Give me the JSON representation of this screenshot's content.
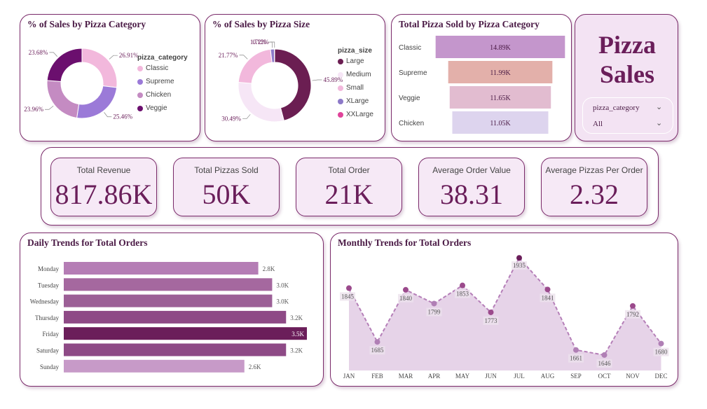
{
  "category_pct": {
    "title": "% of Sales by Pizza Category",
    "legend_title": "pizza_category",
    "colors": [
      "#f2b8dc",
      "#9b7ad8",
      "#c48bc2",
      "#6b0f6e"
    ],
    "labels": [
      "26.91%",
      "25.46%",
      "23.96%",
      "23.68%"
    ]
  },
  "size_pct": {
    "title": "% of Sales by Pizza Size",
    "legend_title": "pizza_size",
    "colors": [
      "#6b1e52",
      "#f6e6f6",
      "#f2b8dc",
      "#8c79c8",
      "#e0439a"
    ],
    "labels": [
      "45.89%",
      "30.49%",
      "21.77%",
      "1.72%",
      "0.12%"
    ]
  },
  "category_sold": {
    "title": "Total Pizza Sold by Pizza Category",
    "colors": [
      "#c496cc",
      "#e3b0aa",
      "#e2bcd0",
      "#ddd4ee"
    ],
    "value_labels": [
      "14.89K",
      "11.99K",
      "11.65K",
      "11.05K"
    ]
  },
  "brand": {
    "title_line1": "Pizza",
    "title_line2": "Sales",
    "filter_label": "pizza_category",
    "filter_value": "All"
  },
  "kpis": [
    {
      "label": "Total Revenue",
      "value": "817.86K"
    },
    {
      "label": "Total Pizzas Sold",
      "value": "50K"
    },
    {
      "label": "Total Order",
      "value": "21K"
    },
    {
      "label": "Average Order Value",
      "value": "38.31"
    },
    {
      "label": "Average Pizzas Per Order",
      "value": "2.32"
    }
  ],
  "daily": {
    "title": "Daily Trends for Total Orders",
    "colors": [
      "#b57db5",
      "#a5689f",
      "#9c5f96",
      "#8e4a86",
      "#6b1e5a",
      "#8e4a86",
      "#c79ac8"
    ],
    "value_labels": [
      "2.8K",
      "3.0K",
      "3.0K",
      "3.2K",
      "3.5K",
      "3.2K",
      "2.6K"
    ]
  },
  "monthly": {
    "title": "Monthly Trends for Total Orders"
  },
  "chart_data": [
    {
      "type": "pie",
      "title": "% of Sales by Pizza Category",
      "categories": [
        "Classic",
        "Supreme",
        "Chicken",
        "Veggie"
      ],
      "values": [
        26.91,
        25.46,
        23.96,
        23.68
      ]
    },
    {
      "type": "pie",
      "title": "% of Sales by Pizza Size",
      "categories": [
        "Large",
        "Medium",
        "Small",
        "XLarge",
        "XXLarge"
      ],
      "values": [
        45.89,
        30.49,
        21.77,
        1.72,
        0.12
      ]
    },
    {
      "type": "bar",
      "title": "Total Pizza Sold by Pizza Category",
      "categories": [
        "Classic",
        "Supreme",
        "Veggie",
        "Chicken"
      ],
      "values": [
        14890,
        11990,
        11650,
        11050
      ]
    },
    {
      "type": "bar",
      "title": "Daily Trends for Total Orders",
      "categories": [
        "Monday",
        "Tuesday",
        "Wednesday",
        "Thursday",
        "Friday",
        "Saturday",
        "Sunday"
      ],
      "values": [
        2800,
        3000,
        3000,
        3200,
        3500,
        3200,
        2600
      ]
    },
    {
      "type": "area",
      "title": "Monthly Trends for Total Orders",
      "categories": [
        "JAN",
        "FEB",
        "MAR",
        "APR",
        "MAY",
        "JUN",
        "JUL",
        "AUG",
        "SEP",
        "OCT",
        "NOV",
        "DEC"
      ],
      "values": [
        1845,
        1685,
        1840,
        1799,
        1853,
        1773,
        1935,
        1841,
        1661,
        1646,
        1792,
        1680
      ]
    }
  ]
}
